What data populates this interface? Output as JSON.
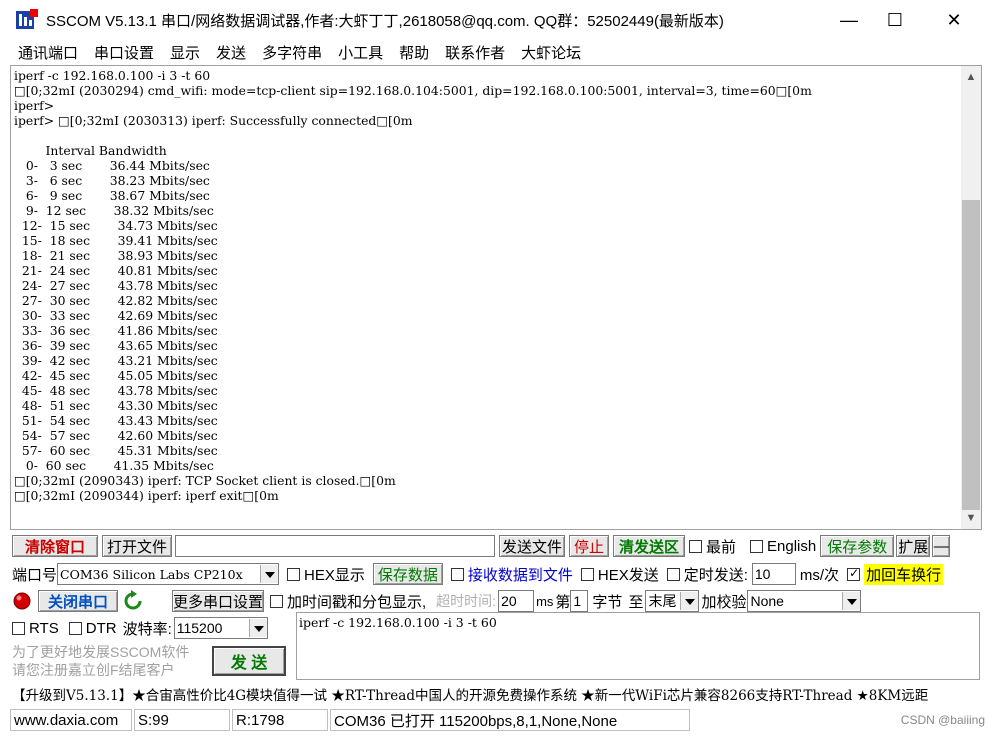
{
  "window": {
    "title": "SSCOM V5.13.1 串口/网络数据调试器,作者:大虾丁丁,2618058@qq.com. QQ群：52502449(最新版本)",
    "minimize": "—",
    "maximize": "☐",
    "close": "✕"
  },
  "menu": [
    "通讯端口",
    "串口设置",
    "显示",
    "发送",
    "多字符串",
    "小工具",
    "帮助",
    "联系作者",
    "大虾论坛"
  ],
  "output": {
    "text": "iperf -c 192.168.0.100 -i 3 -t 60\n□[0;32mI (2030294) cmd_wifi: mode=tcp-client sip=192.168.0.104:5001, dip=192.168.0.100:5001, interval=3, time=60□[0m\niperf>\niperf> □[0;32mI (2030313) iperf: Successfully connected□[0m\n\n        Interval Bandwidth\n   0-   3 sec       36.44 Mbits/sec\n   3-   6 sec       38.23 Mbits/sec\n   6-   9 sec       38.67 Mbits/sec\n   9-  12 sec       38.32 Mbits/sec\n  12-  15 sec       34.73 Mbits/sec\n  15-  18 sec       39.41 Mbits/sec\n  18-  21 sec       38.93 Mbits/sec\n  21-  24 sec       40.81 Mbits/sec\n  24-  27 sec       43.78 Mbits/sec\n  27-  30 sec       42.82 Mbits/sec\n  30-  33 sec       42.69 Mbits/sec\n  33-  36 sec       41.86 Mbits/sec\n  36-  39 sec       43.65 Mbits/sec\n  39-  42 sec       43.21 Mbits/sec\n  42-  45 sec       45.05 Mbits/sec\n  45-  48 sec       43.78 Mbits/sec\n  48-  51 sec       43.30 Mbits/sec\n  51-  54 sec       43.43 Mbits/sec\n  54-  57 sec       42.60 Mbits/sec\n  57-  60 sec       45.31 Mbits/sec\n   0-  60 sec       41.35 Mbits/sec\n□[0;32mI (2090343) iperf: TCP Socket client is closed.□[0m\n□[0;32mI (2090344) iperf: iperf exit□[0m"
  },
  "toolbar": {
    "clear_window": "清除窗口",
    "open_file": "打开文件",
    "file_path": "",
    "send_file": "发送文件",
    "stop": "停止",
    "clear_send": "清发送区",
    "topmost": "最前",
    "english": "English",
    "save_params": "保存参数",
    "expand": "扩展",
    "collapse": "—"
  },
  "port_row": {
    "port_label": "端口号",
    "port_value": "COM36 Silicon Labs CP210x",
    "hex_display": "HEX显示",
    "save_data": "保存数据",
    "recv_to_file": "接收数据到文件",
    "hex_send": "HEX发送",
    "timed_send": "定时发送:",
    "interval": "10",
    "interval_unit": "ms/次",
    "add_crlf": "加回车换行"
  },
  "open_row": {
    "close_port": "关闭串口",
    "more_settings": "更多串口设置",
    "timestamp": "加时间戳和分包显示,",
    "timeout_label": "超时时间:",
    "timeout_value": "20",
    "ms": "ms",
    "nth": "第",
    "byte_index": "1",
    "byte": "字节",
    "to": "至",
    "end_value": "末尾",
    "checksum_label": "加校验",
    "checksum_value": "None"
  },
  "baud_row": {
    "rts": "RTS",
    "dtr": "DTR",
    "baud_label": "波特率:",
    "baud_value": "115200"
  },
  "send_text": "iperf -c 192.168.0.100 -i 3 -t 60",
  "promo": {
    "line1": "为了更好地发展SSCOM软件",
    "line2": "请您注册嘉立创F结尾客户",
    "send_button": "发  送"
  },
  "ticker": "【升级到V5.13.1】★合宙高性价比4G模块值得一试 ★RT-Thread中国人的开源免费操作系统 ★新一代WiFi芯片兼容8266支持RT-Thread ★8KM远距",
  "status": {
    "website": "www.daxia.com",
    "sent": "S:99",
    "received": "R:1798",
    "port_status": "COM36 已打开  115200bps,8,1,None,None",
    "watermark": "CSDN @baiiing"
  },
  "colors": {
    "accent_red": "#cc0000",
    "accent_green": "#007a00",
    "highlight_yellow": "#ffff00",
    "chrome_gray": "#f0f0f0"
  }
}
